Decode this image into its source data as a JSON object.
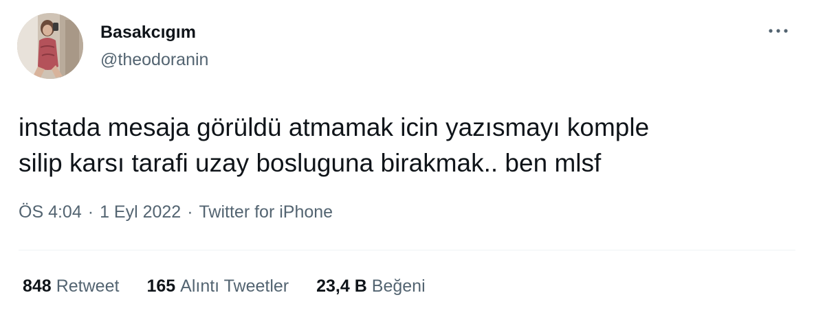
{
  "user": {
    "display_name": "Basakcıgım",
    "handle": "@theodoranin"
  },
  "tweet": {
    "text": "instada mesaja görüldü atmamak icin yazısmayı komple\nsilip karsı tarafi uzay bosluguna birakmak.. ben mlsf",
    "time": "ÖS 4:04",
    "date": "1 Eyl 2022",
    "source": "Twitter for iPhone",
    "separator": "·"
  },
  "stats": {
    "retweets": {
      "count": "848",
      "label": "Retweet"
    },
    "quotes": {
      "count": "165",
      "label": "Alıntı Tweetler"
    },
    "likes": {
      "count": "23,4 B",
      "label": "Beğeni"
    }
  },
  "icons": {
    "more": "more-horizontal-icon"
  },
  "colors": {
    "text_primary": "#0f1419",
    "text_secondary": "#536471",
    "divider": "#eff3f4"
  }
}
